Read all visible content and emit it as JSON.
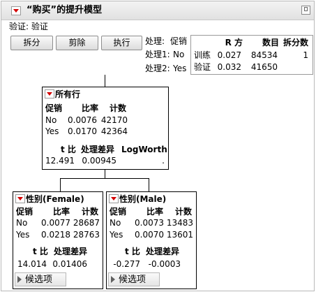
{
  "title": "“购买”的提升模型",
  "validation_label": "验证: 验证",
  "buttons": {
    "split": "拆分",
    "prune": "剪除",
    "go": "执行"
  },
  "treatment": {
    "label": "处理:",
    "value": "促销",
    "t1_label": "处理1:",
    "t1_value": "No",
    "t2_label": "处理2:",
    "t2_value": "Yes"
  },
  "fit_table": {
    "headers": [
      "R 方",
      "数目",
      "拆分数"
    ],
    "rows": [
      {
        "label": "训练",
        "rsq": "0.027",
        "n": "84534",
        "splits": "1"
      },
      {
        "label": "验证",
        "rsq": "0.032",
        "n": "41650",
        "splits": ""
      }
    ]
  },
  "root": {
    "title": "所有行",
    "col_group": "促销",
    "col_rate": "比率",
    "col_count": "计数",
    "rows": [
      {
        "label": "No",
        "rate": "0.0076",
        "count": "42170"
      },
      {
        "label": "Yes",
        "rate": "0.0170",
        "count": "42364"
      }
    ],
    "tratio_label": "t 比",
    "diff_label": "处理差异",
    "logworth_label": "LogWorth",
    "tratio": "12.491",
    "diff": "0.00945",
    "logworth": "."
  },
  "left": {
    "title": "性别(Female)",
    "col_group": "促销",
    "col_rate": "比率",
    "col_count": "计数",
    "rows": [
      {
        "label": "No",
        "rate": "0.0077",
        "count": "28687"
      },
      {
        "label": "Yes",
        "rate": "0.0218",
        "count": "28763"
      }
    ],
    "tratio_label": "t 比",
    "diff_label": "处理差异",
    "tratio": "14.014",
    "diff": "0.01406",
    "candidates": "候选项"
  },
  "right": {
    "title": "性别(Male)",
    "col_group": "促销",
    "col_rate": "比率",
    "col_count": "计数",
    "rows": [
      {
        "label": "No",
        "rate": "0.0073",
        "count": "13483"
      },
      {
        "label": "Yes",
        "rate": "0.0070",
        "count": "13601"
      }
    ],
    "tratio_label": "t 比",
    "diff_label": "处理差异",
    "tratio": "-0.277",
    "diff": "-0.0003",
    "candidates": "候选项"
  }
}
